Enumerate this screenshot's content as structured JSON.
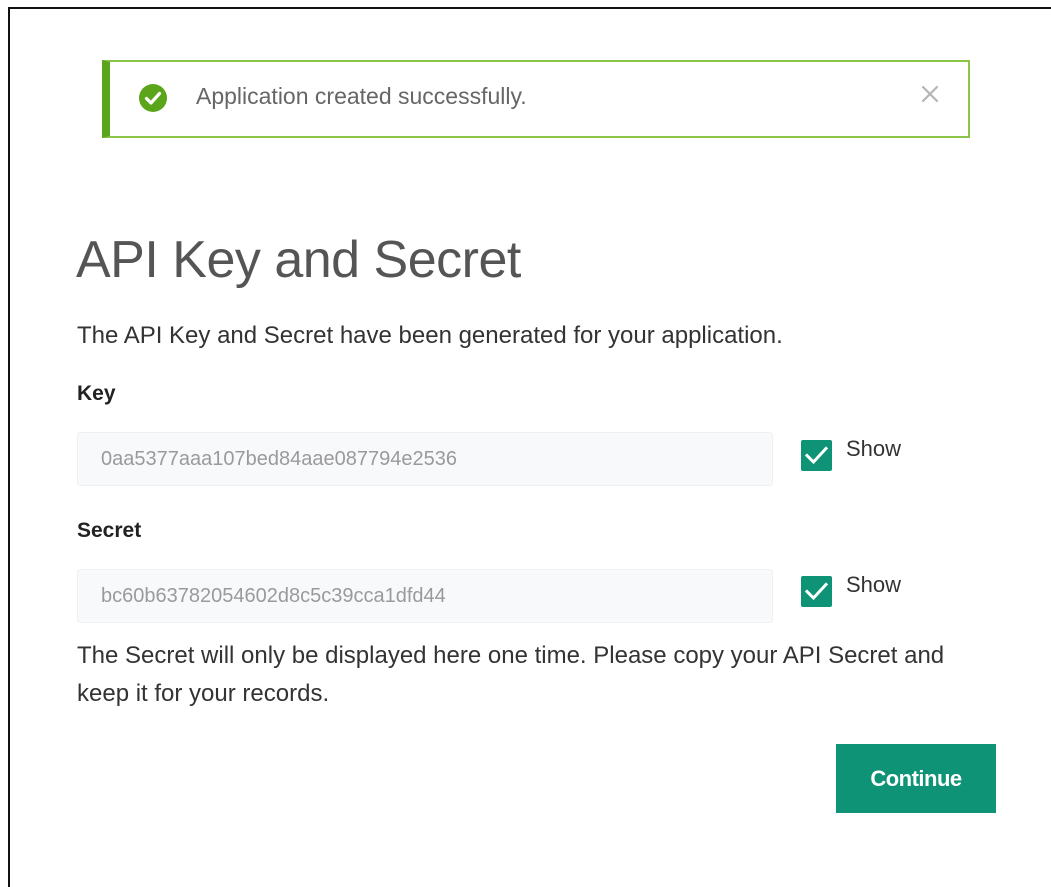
{
  "alert": {
    "message": "Application created successfully.",
    "icon": "check-circle-icon",
    "close_icon": "close-icon",
    "success_color": "#5aa51a"
  },
  "page": {
    "title": "API Key and Secret",
    "intro": "The API Key and Secret have been generated for your application."
  },
  "key": {
    "label": "Key",
    "value": "0aa5377aaa107bed84aae087794e2536",
    "show_label": "Show",
    "show_checked": true
  },
  "secret": {
    "label": "Secret",
    "value": "bc60b63782054602d8c5c39cca1dfd44",
    "show_label": "Show",
    "show_checked": true
  },
  "note": "The Secret will only be displayed here one time. Please copy your API Secret and keep it for your records.",
  "actions": {
    "continue_label": "Continue",
    "accent_color": "#0e9376"
  }
}
